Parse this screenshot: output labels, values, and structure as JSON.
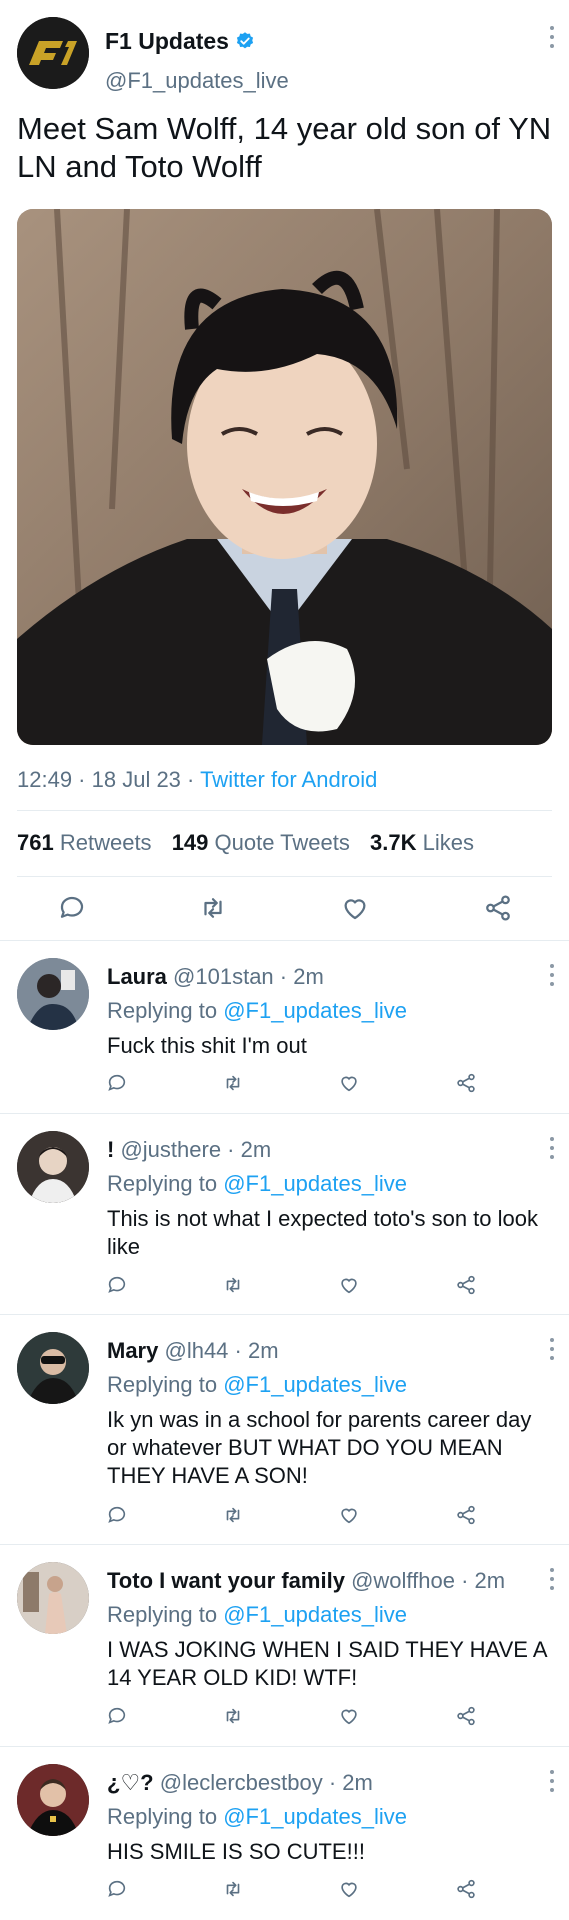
{
  "tweet": {
    "display_name": "F1 Updates",
    "handle": "@F1_updates_live",
    "text": "Meet Sam Wolff, 14 year old son of YN LN and Toto Wolff",
    "time": "12:49",
    "date": "18 Jul 23",
    "source": "Twitter for Android",
    "sep": " · ",
    "stats": {
      "retweets_count": "761",
      "retweets_label": "Retweets",
      "quotes_count": "149",
      "quotes_label": "Quote Tweets",
      "likes_count": "3.7K",
      "likes_label": "Likes"
    }
  },
  "replies": [
    {
      "name": "Laura",
      "handle": "@101stan",
      "age": "2m",
      "replying_label": "Replying to",
      "replying_to": "@F1_updates_live",
      "text": "Fuck this shit I'm out"
    },
    {
      "name": "!",
      "handle": "@justhere",
      "age": "2m",
      "replying_label": "Replying to",
      "replying_to": "@F1_updates_live",
      "text": "This is not what I expected toto's son to look like"
    },
    {
      "name": "Mary",
      "handle": "@lh44",
      "age": "2m",
      "replying_label": "Replying to",
      "replying_to": "@F1_updates_live",
      "text": "Ik yn was in a school for parents career day or whatever BUT WHAT DO YOU MEAN THEY HAVE A SON!"
    },
    {
      "name": "Toto I want your family",
      "handle": "@wolffhoe",
      "age": "2m",
      "replying_label": "Replying to",
      "replying_to": "@F1_updates_live",
      "text": "I WAS JOKING WHEN I SAID THEY HAVE A 14 YEAR OLD KID! WTF!"
    },
    {
      "name": "¿♡?",
      "handle": "@leclercbestboy",
      "age": "2m",
      "replying_label": "Replying to",
      "replying_to": "@F1_updates_live",
      "text": "HIS SMILE IS SO CUTE!!!"
    }
  ],
  "icons": {
    "reply": "speech-bubble-icon",
    "retweet": "retweet-icon",
    "like": "heart-icon",
    "share": "share-icon"
  },
  "colors": {
    "accent": "#1da1f2",
    "muted": "#5b7083",
    "divider": "#e6ecf0",
    "logo_gold": "#c9a227"
  }
}
